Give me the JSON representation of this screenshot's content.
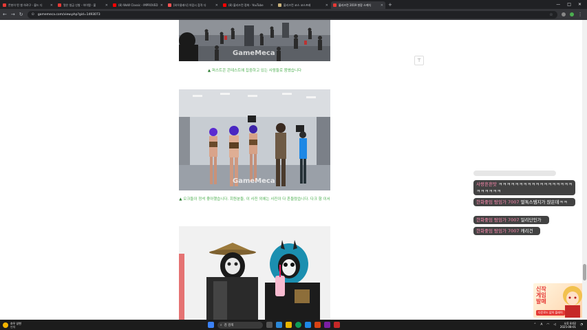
{
  "browser": {
    "tabs": [
      {
        "title": "몬헌이 떤 썰 하려구 - 블드 디",
        "fav": "#e53935",
        "active": false
      },
      {
        "title": "얼은 청금 신발 - 아이템 - 불",
        "fav": "#e53935",
        "active": false
      },
      {
        "title": "(8) WoW Classic - IMPROVED",
        "fav": "#ff0000",
        "active": false
      },
      {
        "title": "[와우클래식] 아랍시 참격 다",
        "fav": "#ff5252",
        "active": false
      },
      {
        "title": "(8) 블리즈컨 정화 - YouTube",
        "fav": "#ff0000",
        "active": false
      },
      {
        "title": "블리즈컨 코스 코스프레",
        "fav": "#c9b17a",
        "active": false
      },
      {
        "title": "블리즈컨 2019 현장 스케치",
        "fav": "#e53935",
        "active": true
      }
    ],
    "new_tab": "+",
    "url": "gamemeca.com/view.php?gid=1493073"
  },
  "page": {
    "watermark": "GameMeca",
    "caption1": "퍼스트콘 콘테스트에 집중하고 있는 사람들로 붐볐습니다",
    "caption2": "오크들이 정석 좋아했습니다. 회원분들, 이 사진 외에는 사진이 다 흔들렸습니다. 다크 함 이서",
    "top_button": "⊤"
  },
  "chat": [
    {
      "user": "사랑흔흔맛",
      "text": "ㅋㅋㅋㅋㅋㅋㅋㅋㅋㅋㅋㅋㅋㅋㅋㅋㅋㅋㅋㅋㅋㅋㅋㅋ"
    },
    {
      "user": "한화좋임 탐임가 7007",
      "text": "멀톡스템지가 않은데ㅋㅋ"
    },
    {
      "user": "한화좋임 탐임가 7007",
      "text": "일리단인가"
    },
    {
      "user": "한화좋임 탐임가 7007",
      "text": "캐리건"
    }
  ],
  "ad": {
    "line1": "신작",
    "line2": "게임",
    "line3": "발매",
    "button": "다운로드 없이 플레이"
  },
  "taskbar": {
    "weather_temp": "흐우 상현",
    "weather_desc": "현재",
    "search_placeholder": "검 검색",
    "lang": "A",
    "time": "오후 8:02",
    "date": "2025-08-01"
  }
}
